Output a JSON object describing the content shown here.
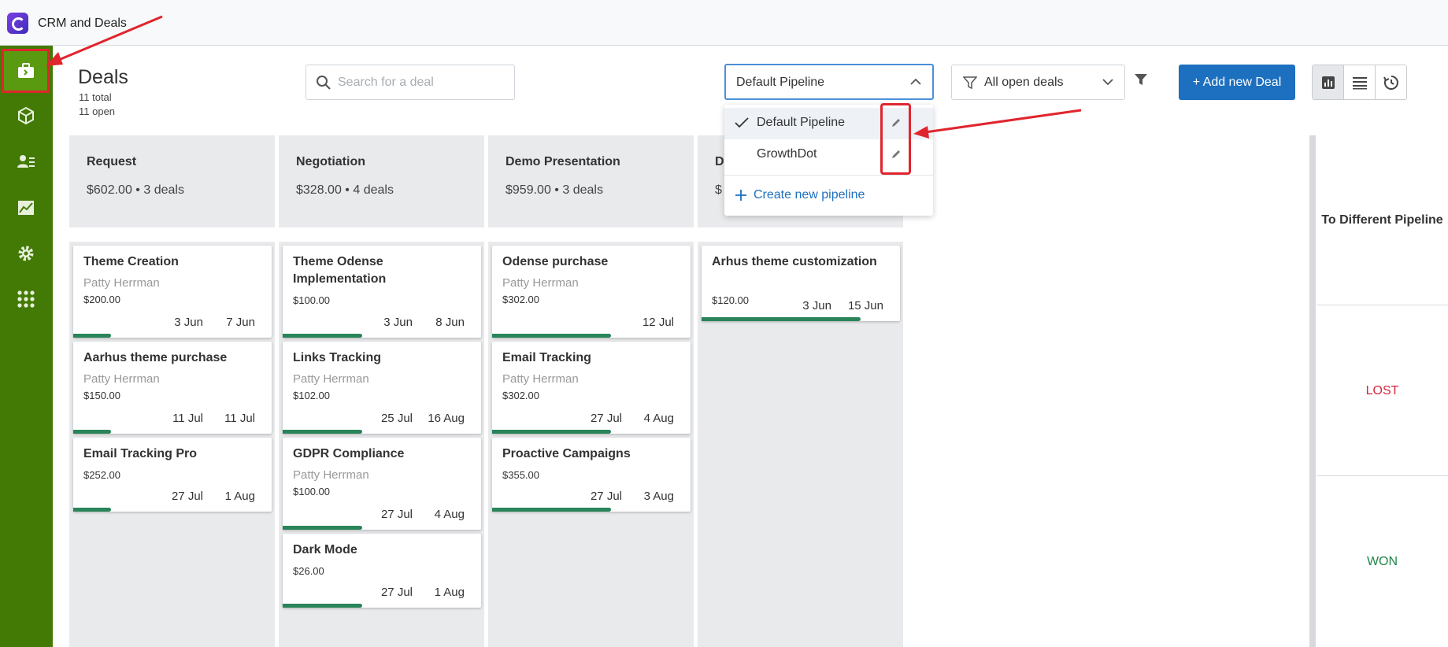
{
  "app": {
    "title": "CRM and Deals"
  },
  "sidebar": {
    "items": [
      {
        "name": "deals",
        "icon": "briefcase-icon",
        "active": true
      },
      {
        "name": "products",
        "icon": "box-icon"
      },
      {
        "name": "contacts",
        "icon": "contact-card-icon"
      },
      {
        "name": "reports",
        "icon": "chart-icon"
      },
      {
        "name": "settings",
        "icon": "gear-icon"
      },
      {
        "name": "apps",
        "icon": "grid-icon"
      }
    ]
  },
  "header": {
    "title": "Deals",
    "total": "11 total",
    "open": "11 open",
    "search_placeholder": "Search for a deal",
    "pipeline_value": "Default Pipeline",
    "filter_value": "All open deals",
    "add_label": "+ Add new Deal"
  },
  "dropdown": {
    "items": [
      "Default Pipeline",
      "GrowthDot"
    ],
    "selected": "Default Pipeline",
    "create_label": "Create new pipeline"
  },
  "columns": [
    {
      "name": "Request",
      "amount": "$602.00",
      "deals": "3 deals",
      "cards": [
        {
          "title": "Theme Creation",
          "person": "Patty Herrman",
          "amount": "$200.00",
          "start": "3 Jun",
          "end": "7 Jun",
          "progress": 0.19
        },
        {
          "title": "Aarhus theme purchase",
          "person": "Patty Herrman",
          "amount": "$150.00",
          "start": "11 Jul",
          "end": "11 Jul",
          "progress": 0.19
        },
        {
          "title": "Email Tracking Pro",
          "person": "",
          "amount": "$252.00",
          "start": "27 Jul",
          "end": "1 Aug",
          "progress": 0.19
        }
      ]
    },
    {
      "name": "Negotiation",
      "amount": "$328.00",
      "deals": "4 deals",
      "cards": [
        {
          "title": "Theme Odense Implementation",
          "person": "",
          "amount": "$100.00",
          "start": "3 Jun",
          "end": "8 Jun",
          "progress": 0.4
        },
        {
          "title": "Links Tracking",
          "person": "Patty Herrman",
          "amount": "$102.00",
          "start": "25 Jul",
          "end": "16 Aug",
          "progress": 0.4
        },
        {
          "title": "GDPR Compliance",
          "person": "Patty Herrman",
          "amount": "$100.00",
          "start": "27 Jul",
          "end": "4 Aug",
          "progress": 0.4
        },
        {
          "title": "Dark Mode",
          "person": "",
          "amount": "$26.00",
          "start": "27 Jul",
          "end": "1 Aug",
          "progress": 0.4
        }
      ]
    },
    {
      "name": "Demo Presentation",
      "amount": "$959.00",
      "deals": "3 deals",
      "cards": [
        {
          "title": "Odense purchase",
          "person": "Patty Herrman",
          "amount": "$302.00",
          "start": "",
          "end": "12 Jul",
          "progress": 0.6
        },
        {
          "title": "Email Tracking",
          "person": "Patty Herrman",
          "amount": "$302.00",
          "start": "27 Jul",
          "end": "4 Aug",
          "progress": 0.6
        },
        {
          "title": "Proactive Campaigns",
          "person": "",
          "amount": "$355.00",
          "start": "27 Jul",
          "end": "3 Aug",
          "progress": 0.6
        }
      ]
    },
    {
      "name": "D",
      "amount": "$",
      "deals": "",
      "cards": [
        {
          "title": "Arhus theme customization",
          "person": "",
          "amount": "$120.00",
          "start": "3 Jun",
          "end": "15 Jun",
          "progress": 0.8
        }
      ]
    }
  ],
  "dropzones": {
    "different": "To Different Pipeline",
    "lost": "LOST",
    "won": "WON"
  },
  "colors": {
    "sidebar": "#437a05",
    "primary": "#1d6fbf",
    "progress": "#29845a",
    "highlight": "#e0252d",
    "lost": "#d7263d",
    "won": "#1e8449"
  }
}
